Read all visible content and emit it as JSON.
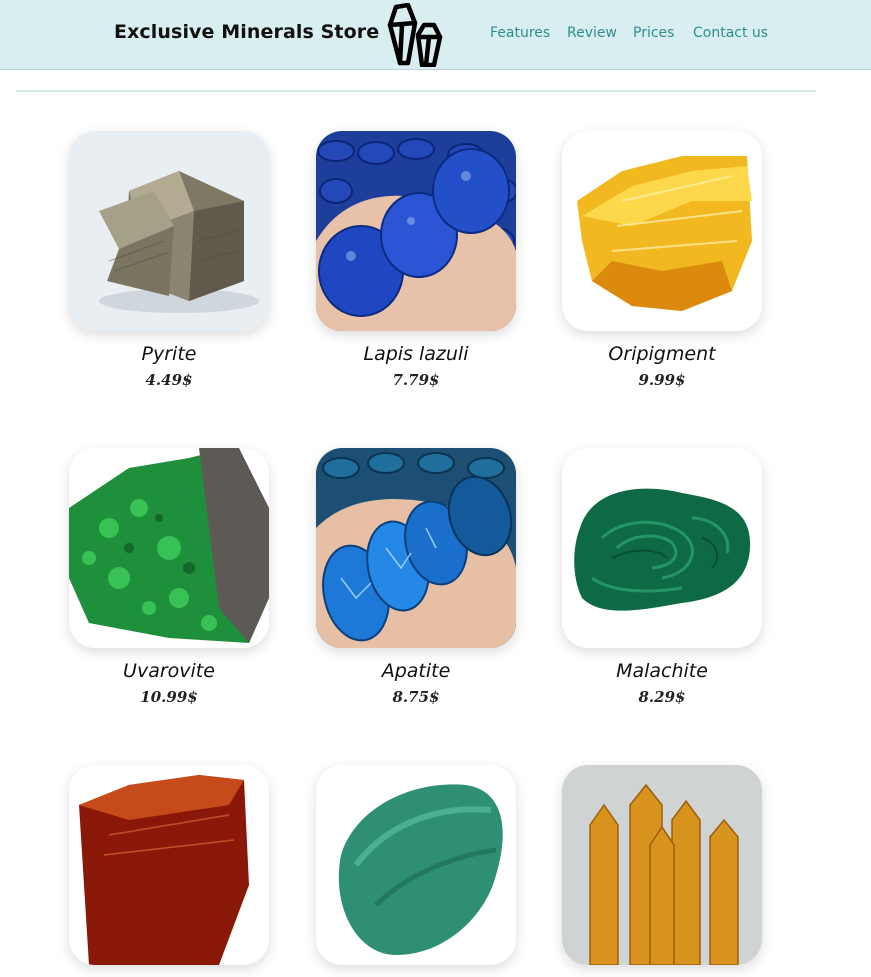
{
  "header": {
    "brand": "Exclusive Minerals Store",
    "logo_icon": "crystals-icon",
    "nav": [
      {
        "label": "Features"
      },
      {
        "label": "Review"
      },
      {
        "label": "Prices"
      },
      {
        "label": "Contact us"
      }
    ]
  },
  "products": [
    {
      "name": "Pyrite",
      "price": "4.49$"
    },
    {
      "name": "Lapis lazuli",
      "price": "7.79$"
    },
    {
      "name": "Oripigment",
      "price": "9.99$"
    },
    {
      "name": "Uvarovite",
      "price": "10.99$"
    },
    {
      "name": "Apatite",
      "price": "8.75$"
    },
    {
      "name": "Malachite",
      "price": "8.29$"
    },
    {
      "name": "",
      "price": ""
    },
    {
      "name": "",
      "price": ""
    },
    {
      "name": "",
      "price": ""
    }
  ],
  "colors": {
    "header_bg": "#d9eef0",
    "nav_text": "#2e8f8a"
  }
}
